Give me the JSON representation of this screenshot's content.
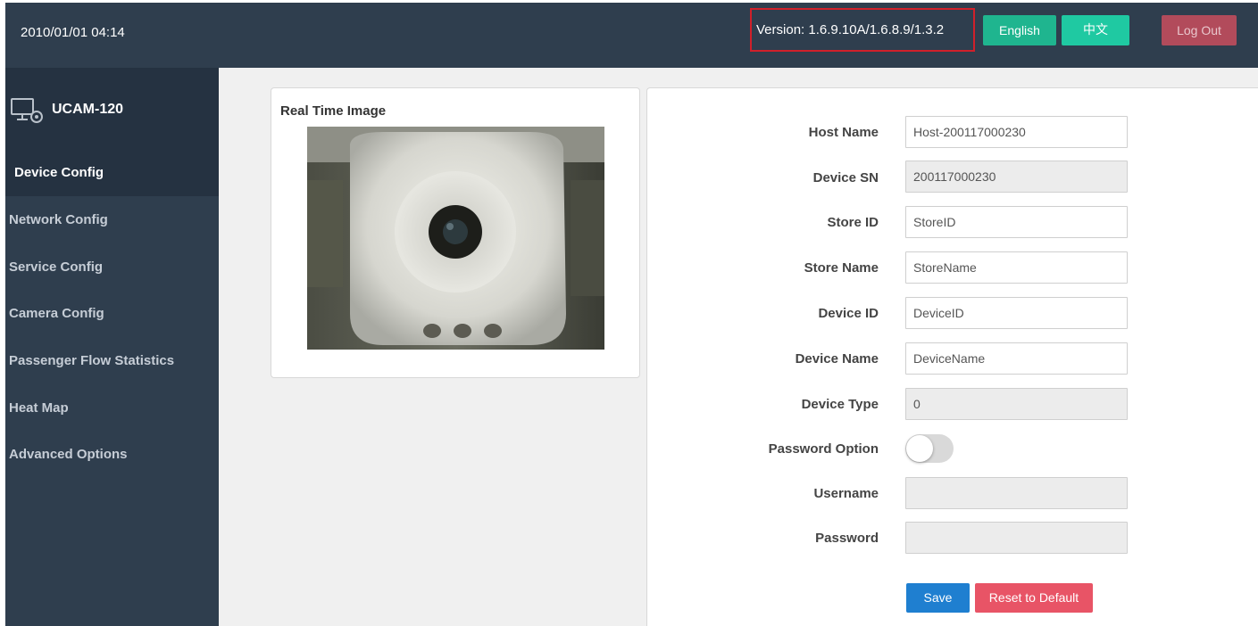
{
  "header": {
    "datetime": "2010/01/01 04:14",
    "version": "Version: 1.6.9.10A/1.6.8.9/1.3.2",
    "english_label": "English",
    "chinese_label": "中文",
    "logout_label": "Log Out"
  },
  "sidebar": {
    "brand": "UCAM-120",
    "items": [
      {
        "label": "Device Config",
        "active": true
      },
      {
        "label": "Network Config"
      },
      {
        "label": "Service Config"
      },
      {
        "label": "Camera Config"
      },
      {
        "label": "Passenger Flow Statistics"
      },
      {
        "label": "Heat Map"
      },
      {
        "label": "Advanced Options"
      }
    ]
  },
  "image_panel": {
    "title": "Real Time Image"
  },
  "form": {
    "host_name": {
      "label": "Host Name",
      "value": "Host-200117000230"
    },
    "device_sn": {
      "label": "Device SN",
      "value": "200117000230"
    },
    "store_id": {
      "label": "Store ID",
      "value": "StoreID"
    },
    "store_name": {
      "label": "Store Name",
      "value": "StoreName"
    },
    "device_id": {
      "label": "Device ID",
      "value": "DeviceID"
    },
    "device_name": {
      "label": "Device Name",
      "value": "DeviceName"
    },
    "device_type": {
      "label": "Device Type",
      "value": "0"
    },
    "password_option": {
      "label": "Password Option",
      "enabled": false
    },
    "username": {
      "label": "Username",
      "value": ""
    },
    "password": {
      "label": "Password",
      "value": ""
    },
    "save_label": "Save",
    "reset_label": "Reset to Default"
  },
  "colors": {
    "topbar": "#2f3e4e",
    "english_button": "#1fb58f",
    "chinese_button": "#1fc9a2",
    "logout_button": "#b24b5b",
    "save_button": "#1f7fd0",
    "reset_button": "#e85466",
    "version_highlight": "#d0202a"
  }
}
